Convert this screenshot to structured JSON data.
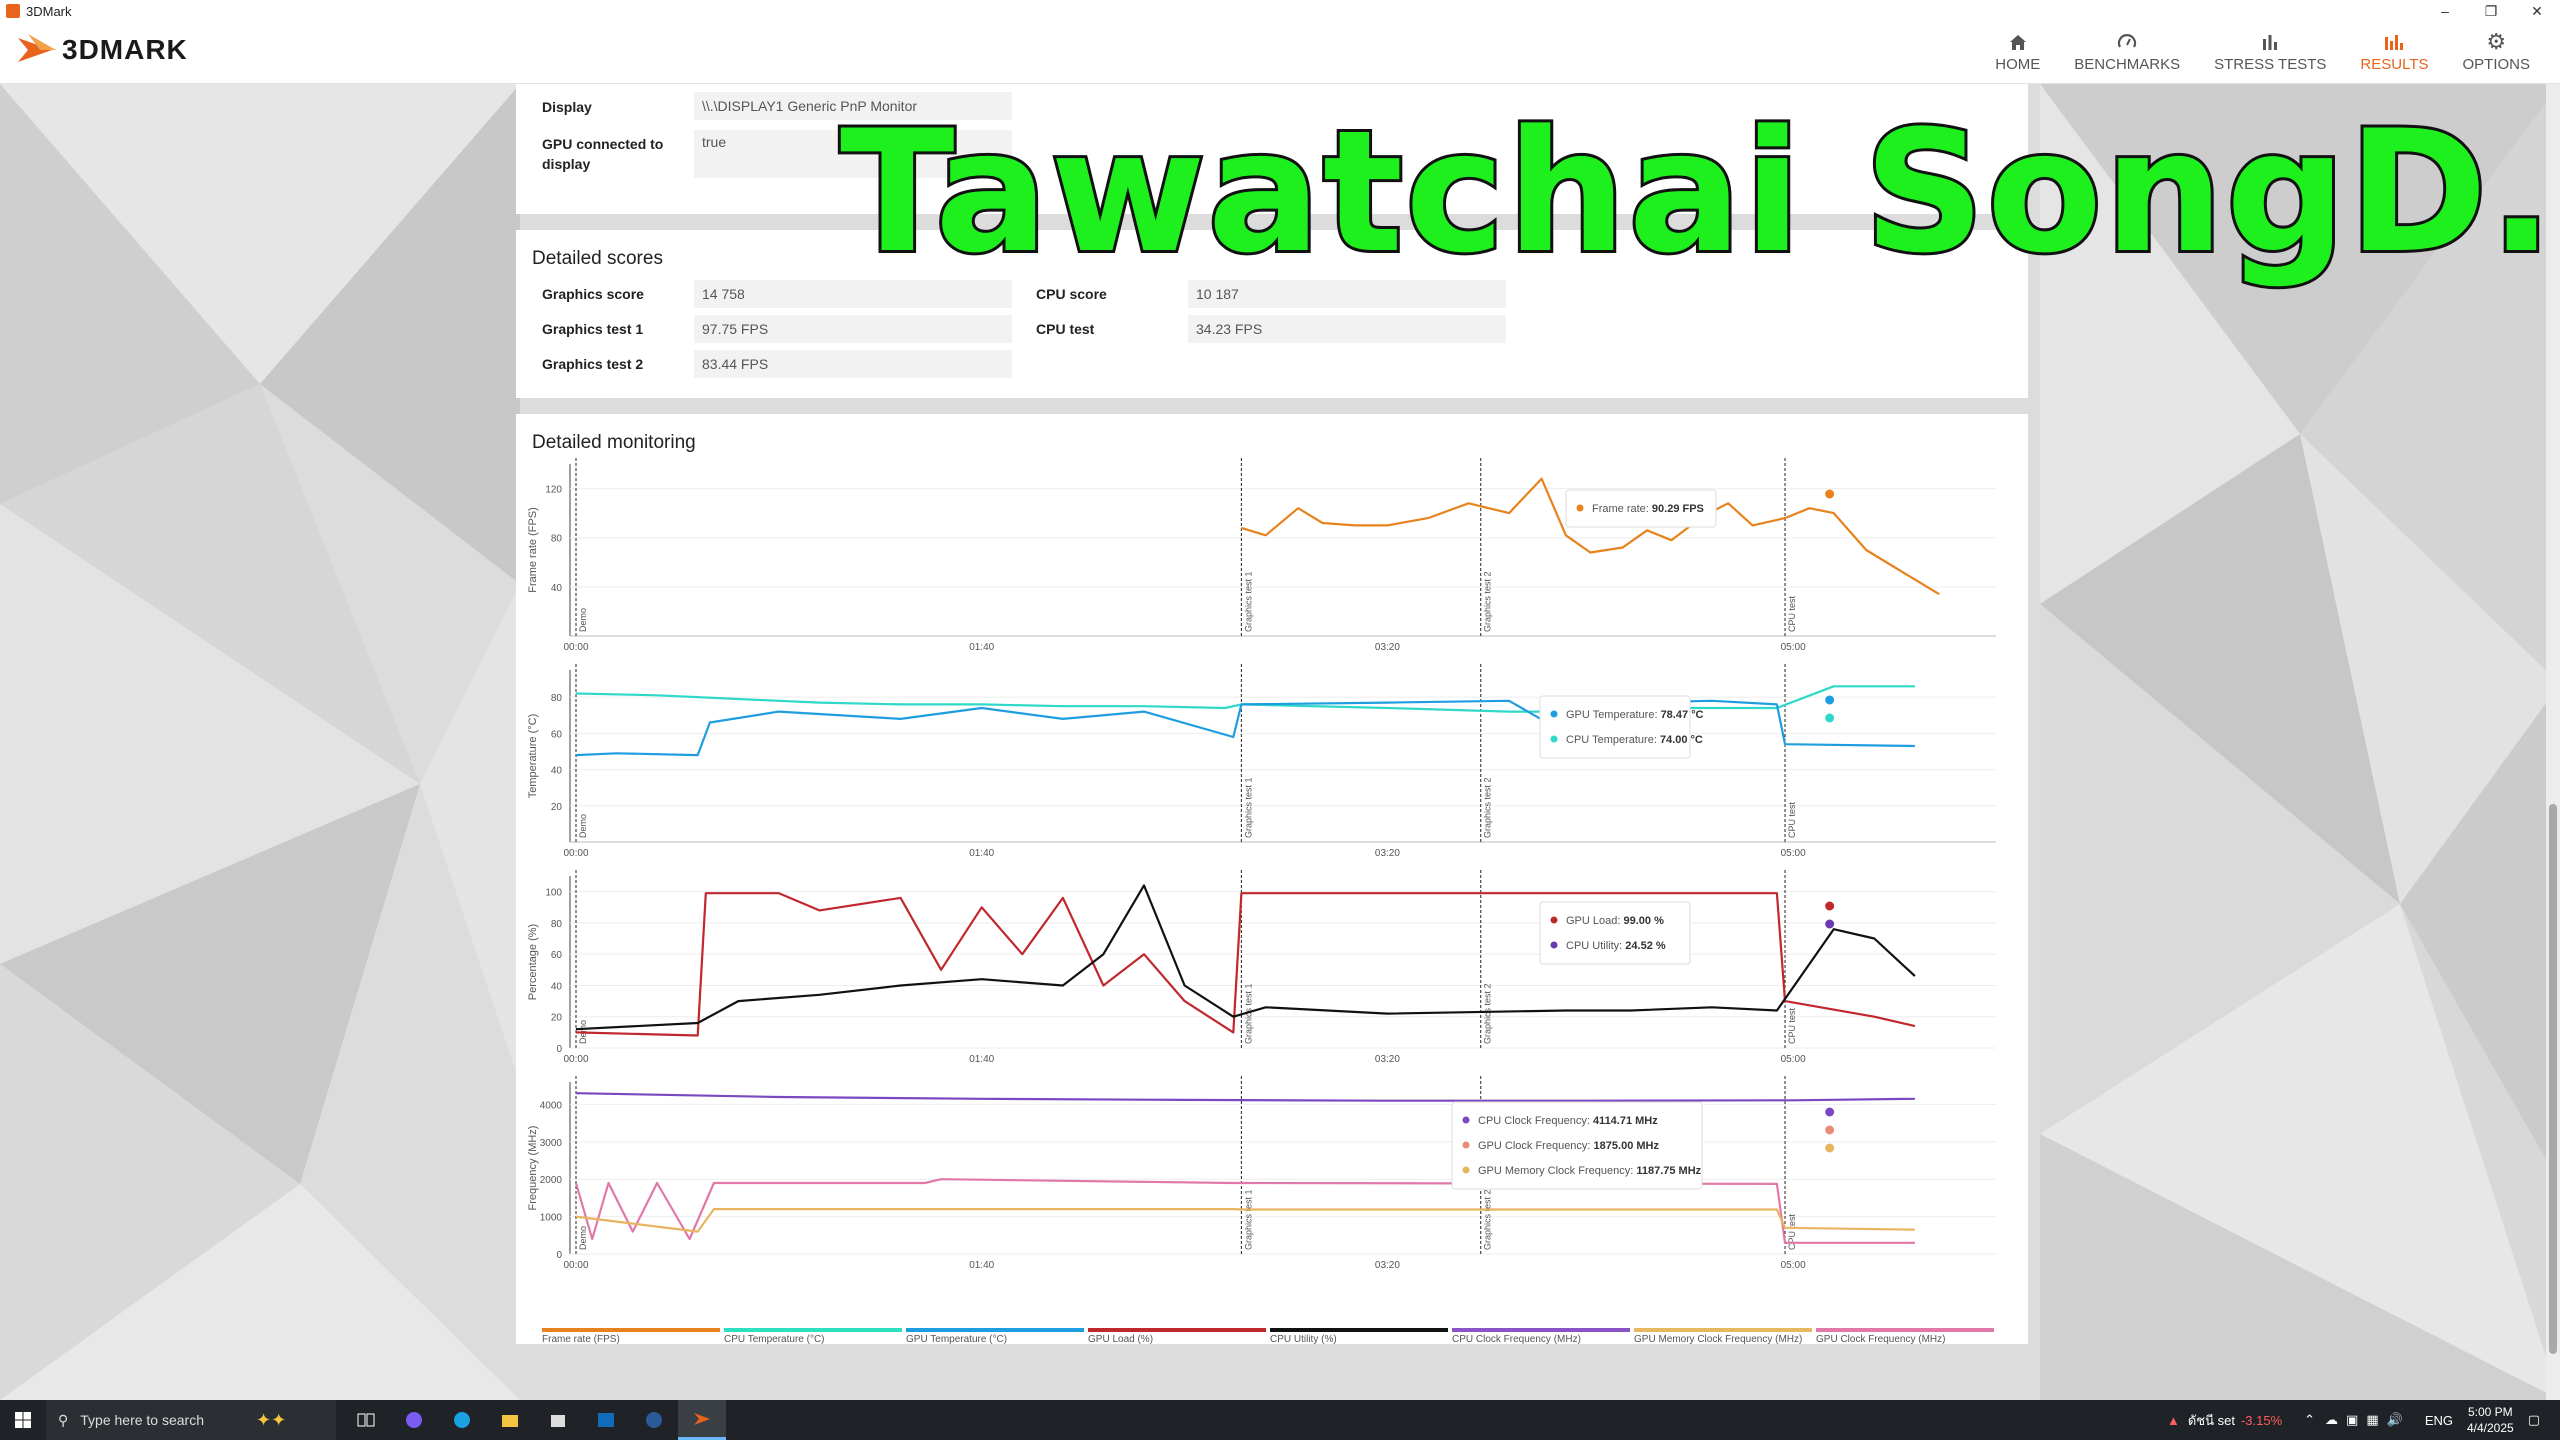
{
  "window": {
    "title": "3DMark"
  },
  "header": {
    "logo_text": "3DMARK",
    "nav": [
      {
        "label": "HOME",
        "icon": "home-icon"
      },
      {
        "label": "BENCHMARKS",
        "icon": "gauge-icon"
      },
      {
        "label": "STRESS TESTS",
        "icon": "bars-icon"
      },
      {
        "label": "RESULTS",
        "icon": "chart-icon",
        "active": true
      },
      {
        "label": "OPTIONS",
        "icon": "gear-icon"
      }
    ],
    "accent": "#e8641c"
  },
  "system_info": {
    "rows": [
      {
        "label": "Display",
        "value": "\\\\.\\DISPLAY1 Generic PnP Monitor"
      },
      {
        "label": "GPU connected to display",
        "value": "true"
      }
    ]
  },
  "detailed_scores": {
    "title": "Detailed scores",
    "left": [
      {
        "label": "Graphics score",
        "value": "14 758"
      },
      {
        "label": "Graphics test 1",
        "value": "97.75 FPS"
      },
      {
        "label": "Graphics test 2",
        "value": "83.44 FPS"
      }
    ],
    "right": [
      {
        "label": "CPU score",
        "value": "10 187"
      },
      {
        "label": "CPU test",
        "value": "34.23 FPS"
      }
    ]
  },
  "monitoring": {
    "title": "Detailed monitoring",
    "x_ticks": [
      "00:00",
      "01:40",
      "03:20",
      "05:00"
    ],
    "markers": [
      "Demo",
      "Graphics test 1",
      "Graphics test 2",
      "CPU test"
    ],
    "tooltips": {
      "fps": [
        {
          "label": "Frame rate",
          "value": "90.29 FPS",
          "color": "#e8821c"
        }
      ],
      "temp": [
        {
          "label": "GPU Temperature",
          "value": "78.47 °C",
          "color": "#1e9ee0"
        },
        {
          "label": "CPU Temperature",
          "value": "74.00 °C",
          "color": "#2fd8c8"
        }
      ],
      "pct": [
        {
          "label": "GPU Load",
          "value": "99.00 %",
          "color": "#c0282e"
        },
        {
          "label": "CPU Utility",
          "value": "24.52 %",
          "color": "#6a3ab0"
        }
      ],
      "freq": [
        {
          "label": "CPU Clock Frequency",
          "value": "4114.71 MHz",
          "color": "#7a48c0"
        },
        {
          "label": "GPU Clock Frequency",
          "value": "1875.00 MHz",
          "color": "#e88c78"
        },
        {
          "label": "GPU Memory Clock Frequency",
          "value": "1187.75 MHz",
          "color": "#e8b460"
        }
      ]
    },
    "legend": [
      {
        "label": "Frame rate (FPS)",
        "color": "#e8821c"
      },
      {
        "label": "CPU Temperature (°C)",
        "color": "#2fe0c0"
      },
      {
        "label": "GPU Temperature (°C)",
        "color": "#1e9ee0"
      },
      {
        "label": "GPU Load (%)",
        "color": "#c0282e"
      },
      {
        "label": "CPU Utility (%)",
        "color": "#111111"
      },
      {
        "label": "CPU Clock Frequency (MHz)",
        "color": "#8a54c8"
      },
      {
        "label": "GPU Memory Clock Frequency (MHz)",
        "color": "#e8b860"
      },
      {
        "label": "GPU Clock Frequency (MHz)",
        "color": "#e078a8"
      }
    ]
  },
  "chart_data": [
    {
      "type": "line",
      "ylabel": "Frame rate (FPS)",
      "y_ticks": [
        40,
        80,
        120
      ],
      "ylim": [
        0,
        140
      ],
      "xlim": [
        0,
        350
      ],
      "series": [
        {
          "name": "Frame rate",
          "x": [
            164,
            170,
            178,
            184,
            192,
            200,
            210,
            220,
            230,
            238,
            244,
            250,
            258,
            264,
            270,
            278,
            284,
            290,
            298,
            304,
            310,
            318,
            328,
            336
          ],
          "y": [
            88,
            82,
            104,
            92,
            90,
            90,
            96,
            108,
            100,
            128,
            82,
            68,
            72,
            86,
            78,
            98,
            108,
            90,
            96,
            104,
            100,
            70,
            50,
            34
          ]
        }
      ]
    },
    {
      "type": "line",
      "ylabel": "Temperature (°C)",
      "y_ticks": [
        20,
        40,
        60,
        80
      ],
      "ylim": [
        0,
        95
      ],
      "xlim": [
        0,
        350
      ],
      "series": [
        {
          "name": "CPU Temperature",
          "x": [
            0,
            20,
            40,
            60,
            80,
            100,
            120,
            140,
            160,
            164,
            200,
            230,
            244,
            250,
            290,
            296,
            310,
            330
          ],
          "y": [
            82,
            81,
            79,
            77,
            76,
            76,
            75,
            75,
            74,
            76,
            74,
            72,
            72,
            74,
            74,
            74,
            86,
            86
          ]
        },
        {
          "name": "GPU Temperature",
          "x": [
            0,
            10,
            30,
            33,
            50,
            80,
            100,
            120,
            140,
            162,
            164,
            200,
            230,
            244,
            246,
            260,
            280,
            296,
            298,
            330
          ],
          "y": [
            48,
            49,
            48,
            66,
            72,
            68,
            74,
            68,
            72,
            58,
            76,
            77,
            78,
            60,
            76,
            77,
            78,
            76,
            54,
            53
          ]
        }
      ]
    },
    {
      "type": "line",
      "ylabel": "Percentage (%)",
      "y_ticks": [
        0,
        20,
        40,
        60,
        80,
        100
      ],
      "ylim": [
        0,
        110
      ],
      "xlim": [
        0,
        350
      ],
      "series": [
        {
          "name": "GPU Load",
          "x": [
            0,
            30,
            32,
            50,
            60,
            80,
            90,
            100,
            110,
            120,
            130,
            140,
            150,
            162,
            164,
            230,
            242,
            244,
            296,
            298,
            320,
            330
          ],
          "y": [
            10,
            8,
            99,
            99,
            88,
            96,
            50,
            90,
            60,
            96,
            40,
            60,
            30,
            10,
            99,
            99,
            99,
            99,
            99,
            30,
            20,
            14
          ]
        },
        {
          "name": "CPU Utility",
          "x": [
            0,
            30,
            40,
            60,
            80,
            100,
            120,
            130,
            140,
            150,
            162,
            170,
            200,
            244,
            260,
            280,
            296,
            310,
            320,
            330
          ],
          "y": [
            12,
            16,
            30,
            34,
            40,
            44,
            40,
            60,
            104,
            40,
            20,
            26,
            22,
            24,
            24,
            26,
            24,
            76,
            70,
            46
          ]
        }
      ]
    },
    {
      "type": "line",
      "ylabel": "Frequency (MHz)",
      "y_ticks": [
        0,
        1000,
        2000,
        3000,
        4000
      ],
      "ylim": [
        0,
        4600
      ],
      "xlim": [
        0,
        350
      ],
      "series": [
        {
          "name": "CPU Clock Frequency",
          "x": [
            0,
            50,
            100,
            150,
            200,
            250,
            300,
            330
          ],
          "y": [
            4300,
            4200,
            4150,
            4120,
            4100,
            4100,
            4110,
            4150
          ]
        },
        {
          "name": "GPU Clock Frequency",
          "x": [
            0,
            4,
            8,
            14,
            20,
            28,
            34,
            36,
            86,
            90,
            162,
            164,
            296,
            298,
            330
          ],
          "y": [
            1900,
            400,
            1900,
            600,
            1900,
            400,
            1900,
            1900,
            1900,
            2000,
            1900,
            1900,
            1875,
            300,
            300
          ]
        },
        {
          "name": "GPU Memory Clock Frequency",
          "x": [
            0,
            30,
            34,
            162,
            164,
            296,
            298,
            330
          ],
          "y": [
            1000,
            600,
            1200,
            1200,
            1190,
            1190,
            700,
            650
          ]
        }
      ]
    }
  ]
}
